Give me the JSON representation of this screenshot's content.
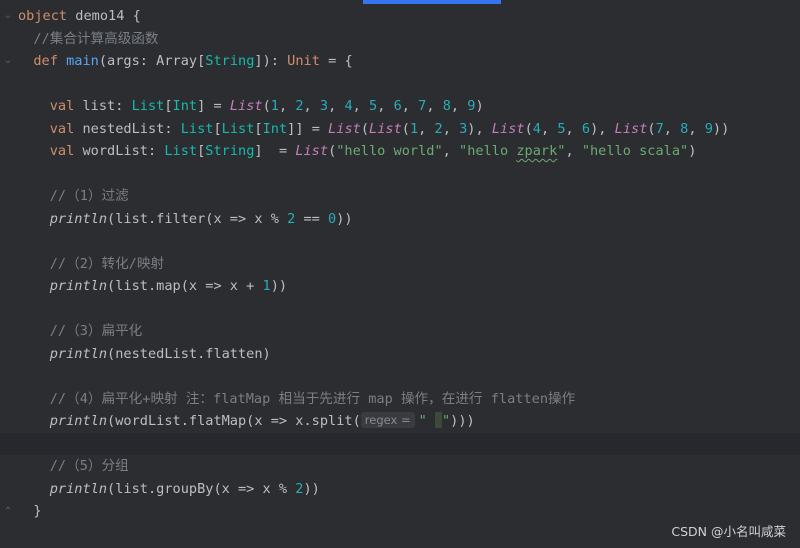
{
  "watermark": "CSDN @小名叫咸菜",
  "code": {
    "l1_kw": "object",
    "l1_name": " demo14 {",
    "l2_comment": "  //集合计算高级函数",
    "l3_kw": "def",
    "l3_fn": "main",
    "l3_args": "(args: ",
    "l3_array": "Array",
    "l3_string": "String",
    "l3_unit": "Unit",
    "l3_tail": " = {",
    "list_kw": "val",
    "list_name": " list: ",
    "list_type1": "List",
    "list_type2": "Int",
    "list_call": "List",
    "list_nums": [
      "1",
      "2",
      "3",
      "4",
      "5",
      "6",
      "7",
      "8",
      "9"
    ],
    "nl_name": " nestedList: ",
    "nl_a": [
      "1",
      "2",
      "3"
    ],
    "nl_b": [
      "4",
      "5",
      "6"
    ],
    "nl_c": [
      "7",
      "8",
      "9"
    ],
    "wl_name": " wordList: ",
    "wl_s1": "\"hello world\"",
    "wl_s2a": "\"hello ",
    "wl_s2b": "zpark",
    "wl_s2c": "\"",
    "wl_s3": "\"hello scala\"",
    "c1": "  //（1）过滤",
    "p1_fn": "println",
    "p1_body": "(list.filter(x => x % ",
    "p1_n1": "2",
    "p1_mid": " == ",
    "p1_n2": "0",
    "p1_end": "))",
    "c2": "  //（2）转化/映射",
    "p2_body": "(list.map(x => x + ",
    "p2_n": "1",
    "p2_end": "))",
    "c3": "  //（3）扁平化",
    "p3_body": "(nestedList.flatten)",
    "c4": "  //（4）扁平化+映射 注：flatMap 相当于先进行 map 操作，在进行 flatten操作",
    "p4_body": "(wordList.flatMap(x => x.split(",
    "p4_hint": "regex =",
    "p4_str1": "\" ",
    "p4_str2": "\"",
    "p4_end": ")))",
    "c5": "  //（5）分组",
    "p5_body": "(list.groupBy(x => x % ",
    "p5_n": "2",
    "p5_end": "))",
    "close": "  }"
  }
}
